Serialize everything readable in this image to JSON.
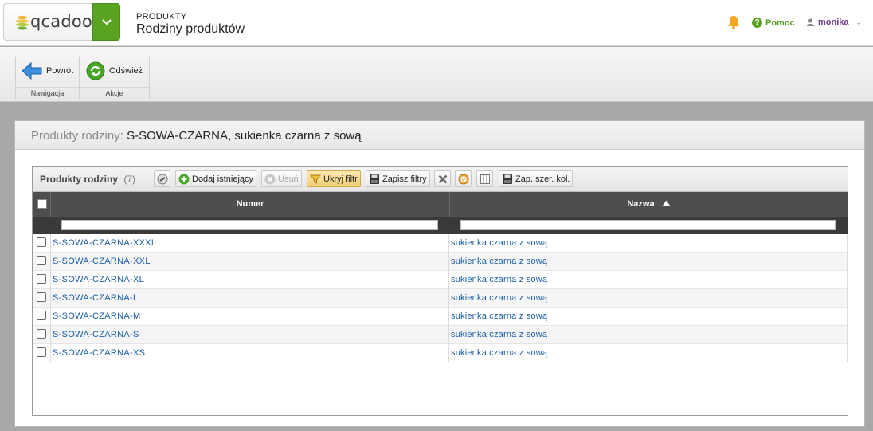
{
  "header": {
    "logo_text": "qcadoo",
    "breadcrumb": "PRODUKTY",
    "title": "Rodziny produktów",
    "help_label": "Pomoc",
    "user_name": "monika"
  },
  "ribbon": {
    "back_label": "Powrót",
    "refresh_label": "Odśwież",
    "group_nav": "Nawigacja",
    "group_actions": "Akcje"
  },
  "panel": {
    "label": "Produkty rodziny:",
    "value": "S-SOWA-CZARNA, sukienka czarna z sową"
  },
  "grid": {
    "title": "Produkty rodziny",
    "count": "(7)",
    "toolbar": {
      "add_existing": "Dodaj istniejący",
      "delete": "Usuń",
      "hide_filter": "Ukryj filtr",
      "save_filters": "Zapisz filtry",
      "save_col_widths": "Zap. szer. kol."
    },
    "columns": {
      "number": "Numer",
      "name": "Nazwa"
    },
    "rows": [
      {
        "number": "S-SOWA-CZARNA-XXXL",
        "name": "sukienka czarna z sową"
      },
      {
        "number": "S-SOWA-CZARNA-XXL",
        "name": "sukienka czarna z sową"
      },
      {
        "number": "S-SOWA-CZARNA-XL",
        "name": "sukienka czarna z sową"
      },
      {
        "number": "S-SOWA-CZARNA-L",
        "name": "sukienka czarna z sową"
      },
      {
        "number": "S-SOWA-CZARNA-M",
        "name": "sukienka czarna z sową"
      },
      {
        "number": "S-SOWA-CZARNA-S",
        "name": "sukienka czarna z sową"
      },
      {
        "number": "S-SOWA-CZARNA-XS",
        "name": "sukienka czarna z sową"
      }
    ]
  },
  "colors": {
    "brand_green": "#5aa322",
    "link_blue": "#1a5fa8",
    "header_dark": "#4e4e4e"
  }
}
